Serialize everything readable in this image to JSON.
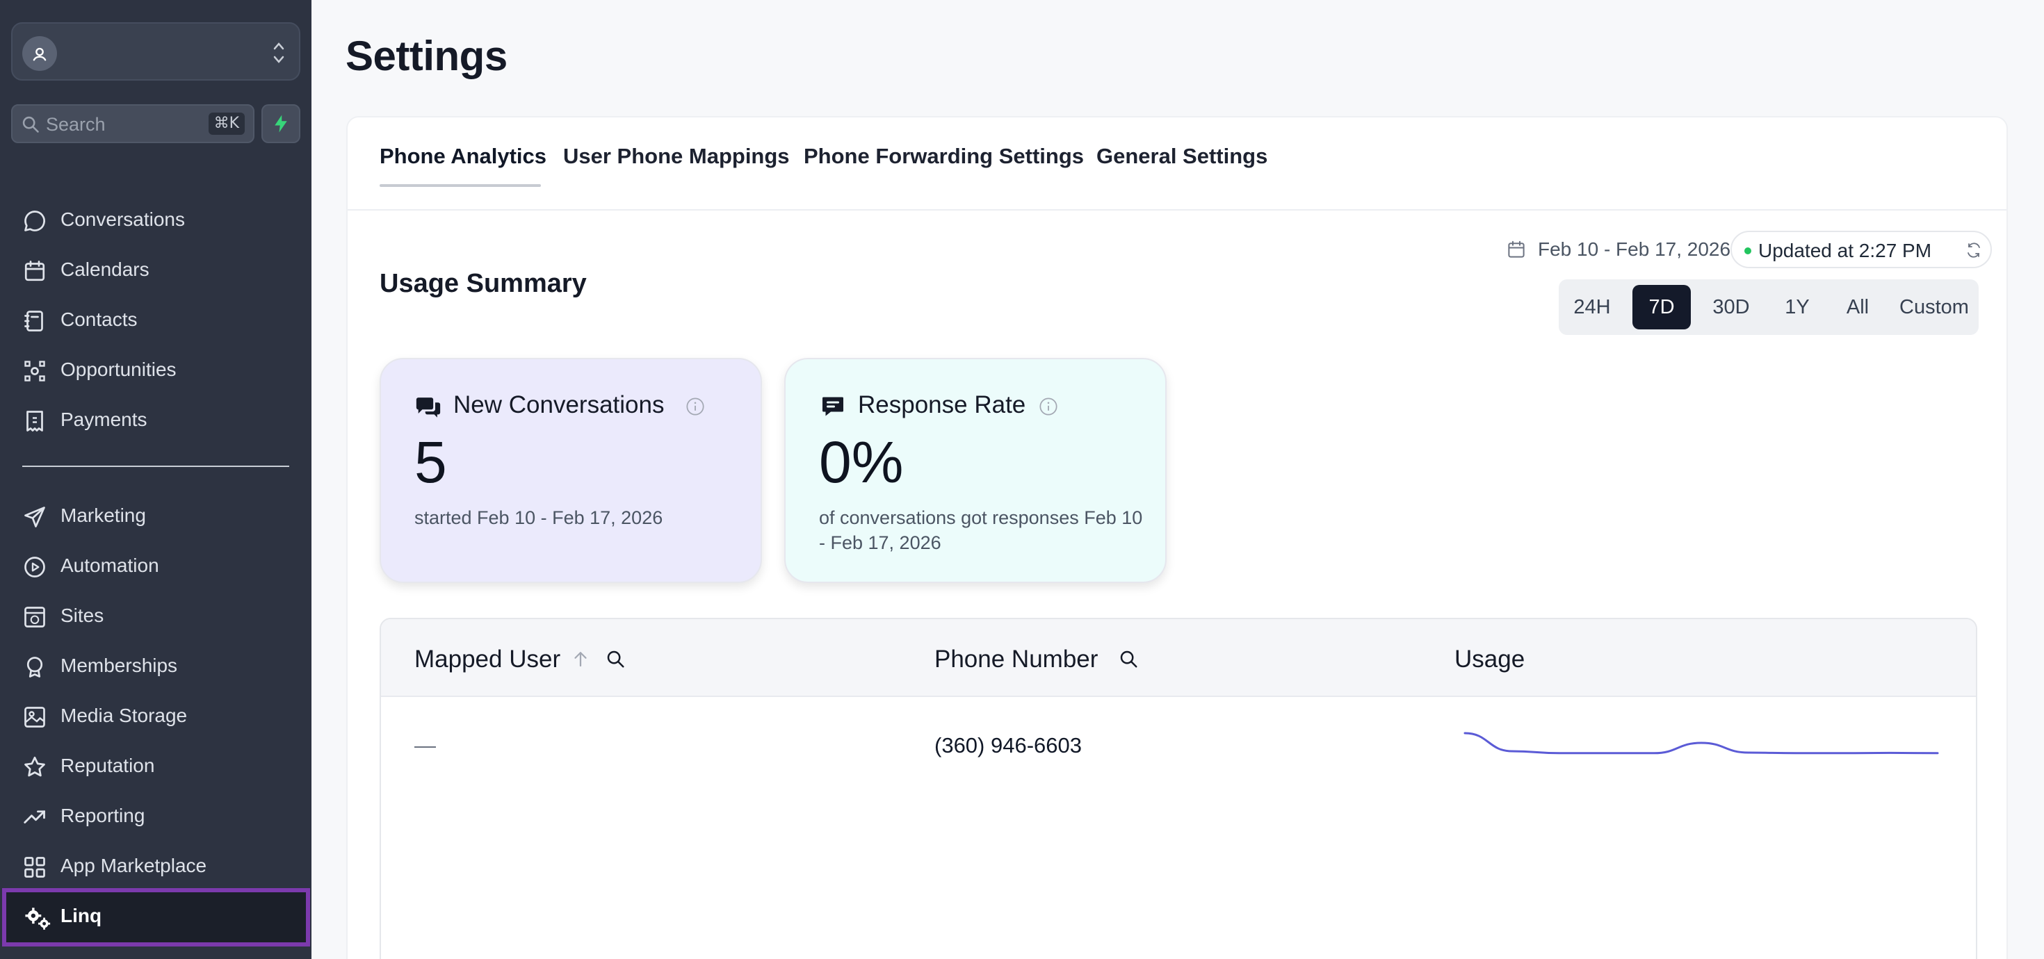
{
  "sidebar": {
    "search": {
      "placeholder": "Search",
      "shortcut": "⌘K"
    },
    "items": [
      {
        "label": "Conversations",
        "icon": "chat-bubble-icon"
      },
      {
        "label": "Calendars",
        "icon": "calendar-icon"
      },
      {
        "label": "Contacts",
        "icon": "contacts-book-icon"
      },
      {
        "label": "Opportunities",
        "icon": "opportunities-icon"
      },
      {
        "label": "Payments",
        "icon": "invoice-icon"
      },
      {
        "label": "Marketing",
        "icon": "send-icon"
      },
      {
        "label": "Automation",
        "icon": "automation-icon"
      },
      {
        "label": "Sites",
        "icon": "globe-window-icon"
      },
      {
        "label": "Memberships",
        "icon": "badge-icon"
      },
      {
        "label": "Media Storage",
        "icon": "image-icon"
      },
      {
        "label": "Reputation",
        "icon": "star-icon"
      },
      {
        "label": "Reporting",
        "icon": "trend-up-icon"
      },
      {
        "label": "App Marketplace",
        "icon": "grid-icon"
      }
    ],
    "active_item": {
      "label": "Linq",
      "icon": "gears-icon"
    }
  },
  "page": {
    "title": "Settings"
  },
  "tabs": [
    {
      "label": "Phone Analytics",
      "active": true
    },
    {
      "label": "User Phone Mappings",
      "active": false
    },
    {
      "label": "Phone Forwarding Settings",
      "active": false
    },
    {
      "label": "General Settings",
      "active": false
    }
  ],
  "summary": {
    "title": "Usage Summary",
    "date_range": "Feb 10 - Feb 17, 2026",
    "updated": "Updated at 2:27 PM",
    "status_color": "#22c55e",
    "ranges": [
      "24H",
      "7D",
      "30D",
      "1Y",
      "All",
      "Custom"
    ],
    "selected_range": "7D"
  },
  "stats": [
    {
      "title": "New Conversations",
      "value": "5",
      "subtitle": "started Feb 10 - Feb 17, 2026",
      "icon": "conversations-icon",
      "bg": "#ebeafc"
    },
    {
      "title": "Response Rate",
      "value": "0%",
      "subtitle": "of conversations got responses Feb 10 - Feb 17, 2026",
      "icon": "message-icon",
      "bg": "#ecfcfb"
    }
  ],
  "table": {
    "columns": [
      "Mapped User",
      "Phone Number",
      "Usage"
    ],
    "rows": [
      {
        "mapped_user": "—",
        "phone_number": "(360) 946-6603",
        "usage": [
          0.0,
          0.65,
          0.72,
          0.72,
          0.72,
          0.35,
          0.7,
          0.72,
          0.72,
          0.71,
          0.72
        ]
      }
    ],
    "sparkline_color": "#5b5bd6"
  }
}
